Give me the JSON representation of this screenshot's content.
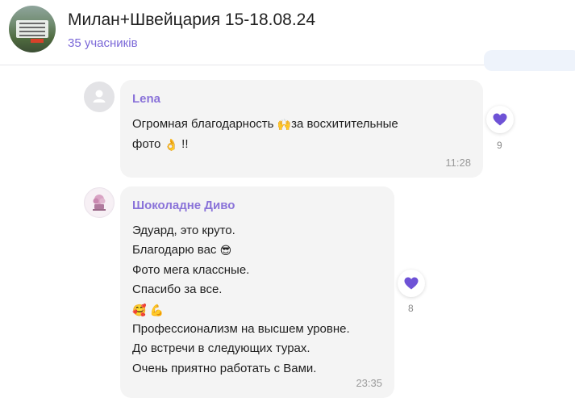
{
  "header": {
    "title": "Милан+Швейцария 15-18.08.24",
    "members": "35 учасників"
  },
  "messages": [
    {
      "sender": "Lena",
      "lines": [
        [
          "Огромная благодарность ",
          "🙌",
          "за восхитительные"
        ],
        [
          "фото ",
          "👌",
          " !!"
        ]
      ],
      "time": "11:28",
      "reaction": {
        "icon": "purple-heart-icon",
        "count": "9"
      }
    },
    {
      "sender": "Шоколадне Диво",
      "lines": [
        "Эдуард, это круто.",
        [
          "Благодарю вас ",
          "😎"
        ],
        "Фото мега классные.",
        "Спасибо за все.",
        [
          "🥰",
          " ",
          "💪"
        ],
        "Профессионализм на высшем уровне.",
        "До встречи в следующих турах.",
        "Очень приятно работать с Вами."
      ],
      "time": "23:35",
      "reaction": {
        "icon": "purple-heart-icon",
        "count": "8"
      }
    }
  ],
  "colors": {
    "accent": "#8a73d9",
    "heart": "#6e52d6",
    "bubble": "#f4f4f4"
  }
}
